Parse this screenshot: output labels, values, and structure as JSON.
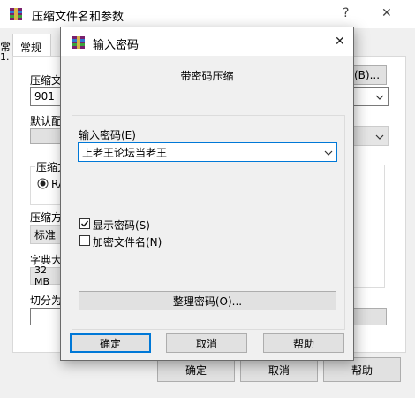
{
  "background_window": {
    "title": "压缩文件名和参数",
    "help_glyph": "?",
    "close_glyph": "✕",
    "tab_left_partial": "常",
    "tab_left_partial2": "1.",
    "tab_general": "常规",
    "label_archive_name": "压缩文",
    "archive_name_value": "901",
    "browse_button": "(B)...",
    "label_default_config": "默认配",
    "label_archive_format": "压缩文",
    "format_rar": "RA",
    "label_compression_method": "压缩方",
    "compression_method_value": "标准",
    "label_dictionary_size": "字典大",
    "dictionary_size_value": "32 MB",
    "label_split": "切分为",
    "ok_button": "确定",
    "cancel_button": "取消",
    "help_button": "帮助"
  },
  "dialog": {
    "title": "输入密码",
    "close_glyph": "✕",
    "header": "带密码压缩",
    "password_label": "输入密码(E)",
    "password_value": "上老王论坛当老王",
    "show_password_label": "显示密码(S)",
    "show_password_checked": true,
    "encrypt_filenames_label": "加密文件名(N)",
    "encrypt_filenames_checked": false,
    "organize_button": "整理密码(O)...",
    "ok_button": "确定",
    "cancel_button": "取消",
    "help_button": "帮助"
  },
  "colors": {
    "accent_focus": "#0078d7",
    "dialog_bg": "#f0f0f0",
    "button_bg": "#e1e1e1"
  },
  "icons": [
    "winrar-icon",
    "help-icon",
    "close-icon",
    "chevron-down-icon",
    "radio-selected-icon",
    "checkbox-checked-icon",
    "checkbox-unchecked-icon"
  ]
}
